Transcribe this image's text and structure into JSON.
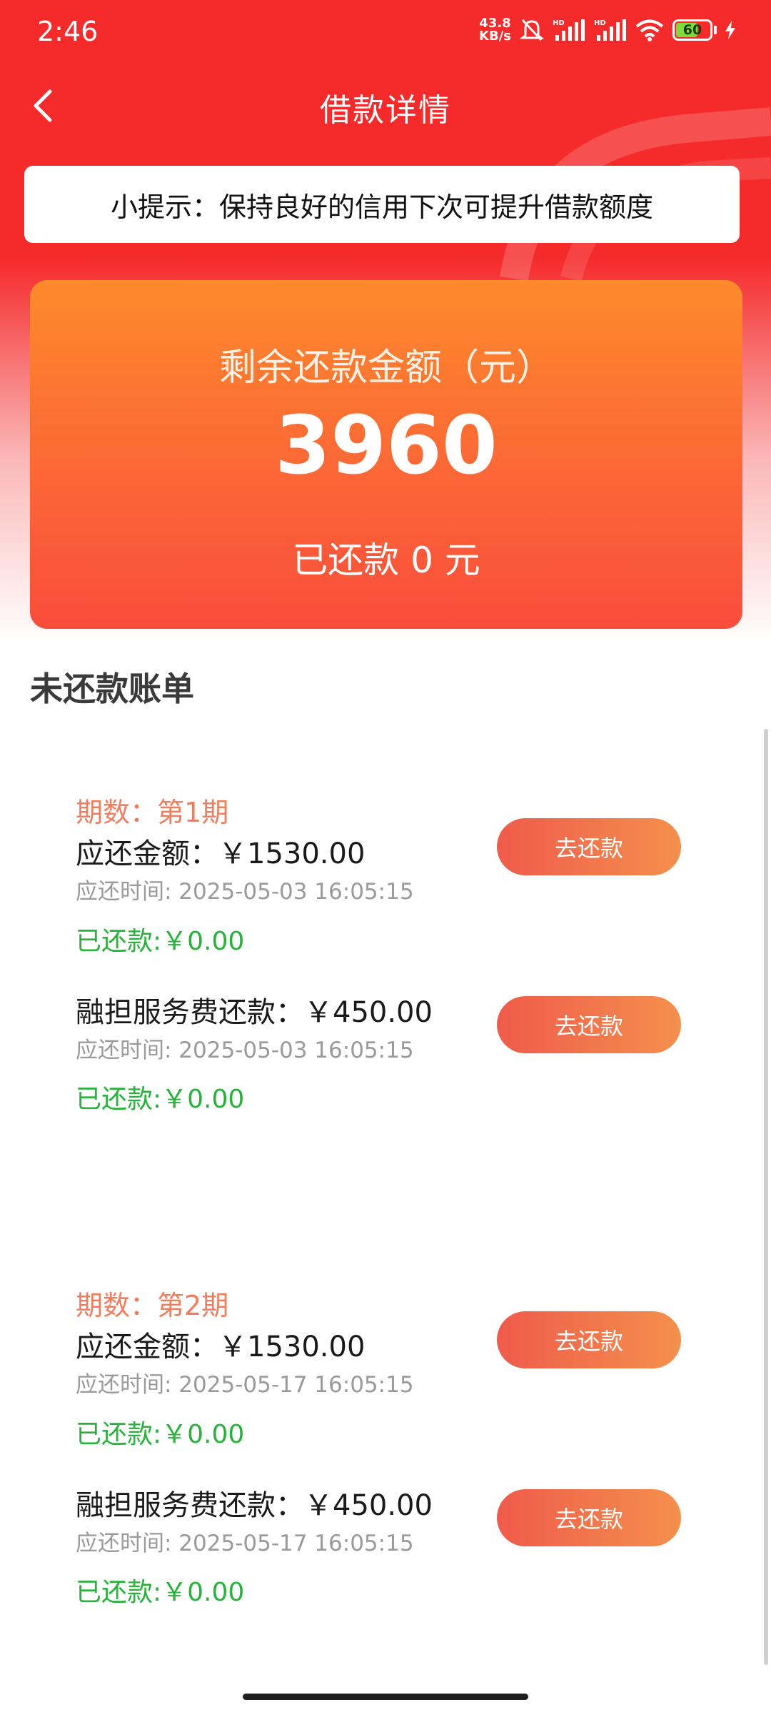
{
  "status_bar": {
    "time": "2:46",
    "net_speed_value": "43.8",
    "net_speed_unit": "KB/s",
    "battery_level": "60",
    "icons": [
      "mute-bell-icon",
      "hd-signal-icon",
      "hd-signal-icon",
      "wifi-icon",
      "battery-icon",
      "charging-icon"
    ]
  },
  "nav": {
    "title": "借款详情",
    "back_icon": "chevron-left-icon"
  },
  "tip": "小提示：保持良好的信用下次可提升借款额度",
  "summary": {
    "label": "剩余还款金额（元）",
    "amount": "3960",
    "paid": "已还款 0 元"
  },
  "section_title": "未还款账单",
  "bills": [
    {
      "period": "期数：第1期",
      "items": [
        {
          "amount": "应还金额：￥1530.00",
          "time": "应还时间: 2025-05-03 16:05:15",
          "paid": "已还款:￥0.00",
          "button": "去还款"
        },
        {
          "amount": "融担服务费还款：￥450.00",
          "time": "应还时间: 2025-05-03 16:05:15",
          "paid": "已还款:￥0.00",
          "button": "去还款"
        }
      ]
    },
    {
      "period": "期数：第2期",
      "items": [
        {
          "amount": "应还金额：￥1530.00",
          "time": "应还时间: 2025-05-17 16:05:15",
          "paid": "已还款:￥0.00",
          "button": "去还款"
        },
        {
          "amount": "融担服务费还款：￥450.00",
          "time": "应还时间: 2025-05-17 16:05:15",
          "paid": "已还款:￥0.00",
          "button": "去还款"
        }
      ]
    }
  ],
  "colors": {
    "header_red": "#f52a2a",
    "card_orange": "#fc6a35",
    "period_text": "#f07e5e",
    "paid_green": "#27b33a",
    "button_start": "#ef5b4b",
    "button_end": "#f4904c"
  }
}
